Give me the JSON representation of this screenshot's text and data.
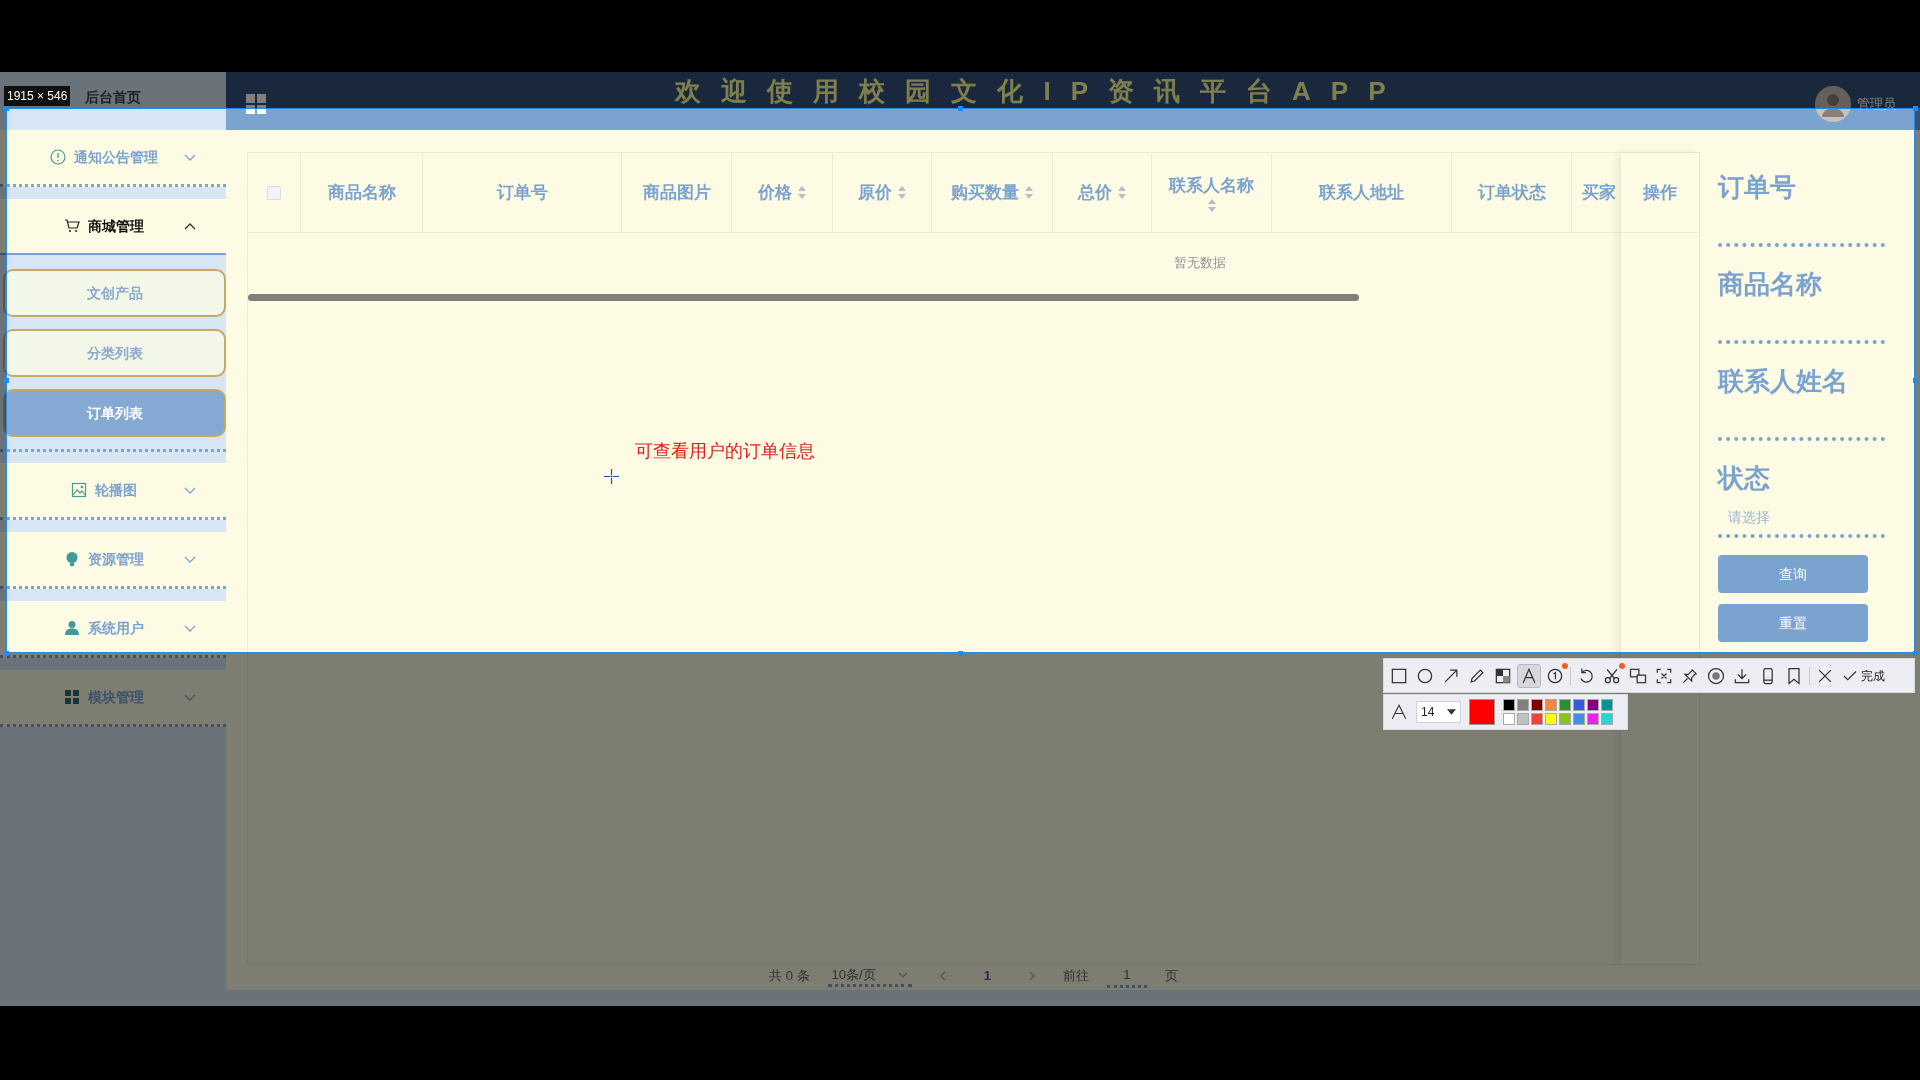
{
  "header": {
    "home": "后台首页",
    "title": "欢迎使用校园文化IP资讯平台APP",
    "user": "管理员"
  },
  "sidebar": {
    "items": [
      {
        "label": "通知公告管理",
        "expanded": false
      },
      {
        "label": "商城管理",
        "expanded": true,
        "children": [
          {
            "label": "文创产品",
            "selected": false
          },
          {
            "label": "分类列表",
            "selected": false
          },
          {
            "label": "订单列表",
            "selected": true
          }
        ]
      },
      {
        "label": "轮播图",
        "expanded": false
      },
      {
        "label": "资源管理",
        "expanded": false
      },
      {
        "label": "系统用户",
        "expanded": false
      },
      {
        "label": "模块管理",
        "expanded": false
      }
    ]
  },
  "table": {
    "columns": [
      {
        "kind": "checkbox",
        "checked": false
      },
      {
        "kind": "text",
        "label": "商品名称",
        "sortable": false
      },
      {
        "kind": "text",
        "label": "订单号",
        "sortable": false
      },
      {
        "kind": "text",
        "label": "商品图片",
        "sortable": false
      },
      {
        "kind": "text",
        "label": "价格",
        "sortable": true
      },
      {
        "kind": "text",
        "label": "原价",
        "sortable": true
      },
      {
        "kind": "text",
        "label": "购买数量",
        "sortable": true
      },
      {
        "kind": "text",
        "label": "总价",
        "sortable": true
      },
      {
        "kind": "text",
        "label": "联系人名称",
        "sortable": true
      },
      {
        "kind": "text",
        "label": "联系人地址",
        "sortable": false
      },
      {
        "kind": "text",
        "label": "订单状态",
        "sortable": false
      },
      {
        "kind": "text",
        "label": "买家",
        "sortable": false
      }
    ],
    "fixed_column": "操作",
    "empty_text": "暂无数据"
  },
  "search_panel": {
    "fields": [
      {
        "label": "订单号"
      },
      {
        "label": "商品名称"
      },
      {
        "label": "联系人姓名"
      },
      {
        "label": "状态",
        "placeholder": "请选择"
      }
    ],
    "buttons": [
      "查询",
      "重置"
    ]
  },
  "pagination": {
    "total": "共 0 条",
    "page_size": "10条/页",
    "pages": [
      {
        "label": "1",
        "selected": true
      }
    ],
    "goto_label": "前往",
    "goto_value": "1",
    "page_unit": "页"
  },
  "screen_capture": {
    "size_label": "1915 × 546",
    "annotation": "可查看用户的订单信息",
    "tools": [
      {
        "selected": false,
        "dot": false
      },
      {
        "selected": false,
        "dot": false
      },
      {
        "selected": false,
        "dot": false
      },
      {
        "selected": false,
        "dot": false
      },
      {
        "selected": false,
        "dot": false
      },
      {
        "selected": true,
        "dot": false
      },
      {
        "selected": false,
        "dot": true
      },
      {
        "selected": false,
        "dot": false
      },
      {
        "selected": false,
        "dot": true
      },
      {
        "selected": false,
        "dot": false
      },
      {
        "selected": false,
        "dot": false
      },
      {
        "selected": false,
        "dot": false
      },
      {
        "selected": false,
        "dot": false
      },
      {
        "selected": false,
        "dot": false
      },
      {
        "selected": false,
        "dot": false
      },
      {
        "selected": false,
        "dot": false
      }
    ],
    "done_label": "完成",
    "font_size": "14",
    "current_swatch": {
      "color": "#ff0000"
    },
    "swatches": [
      {
        "color": "#000000"
      },
      {
        "color": "#808080"
      },
      {
        "color": "#800000"
      },
      {
        "color": "#f08a3c"
      },
      {
        "color": "#2e8b2e"
      },
      {
        "color": "#3c5ad2"
      },
      {
        "color": "#800080"
      },
      {
        "color": "#009494"
      },
      {
        "color": "#ffffff"
      },
      {
        "color": "#c0c0c0"
      },
      {
        "color": "#f04040"
      },
      {
        "color": "#ffff00"
      },
      {
        "color": "#90c020"
      },
      {
        "color": "#4090e0"
      },
      {
        "color": "#f020f0"
      },
      {
        "color": "#20d8d8"
      }
    ]
  }
}
